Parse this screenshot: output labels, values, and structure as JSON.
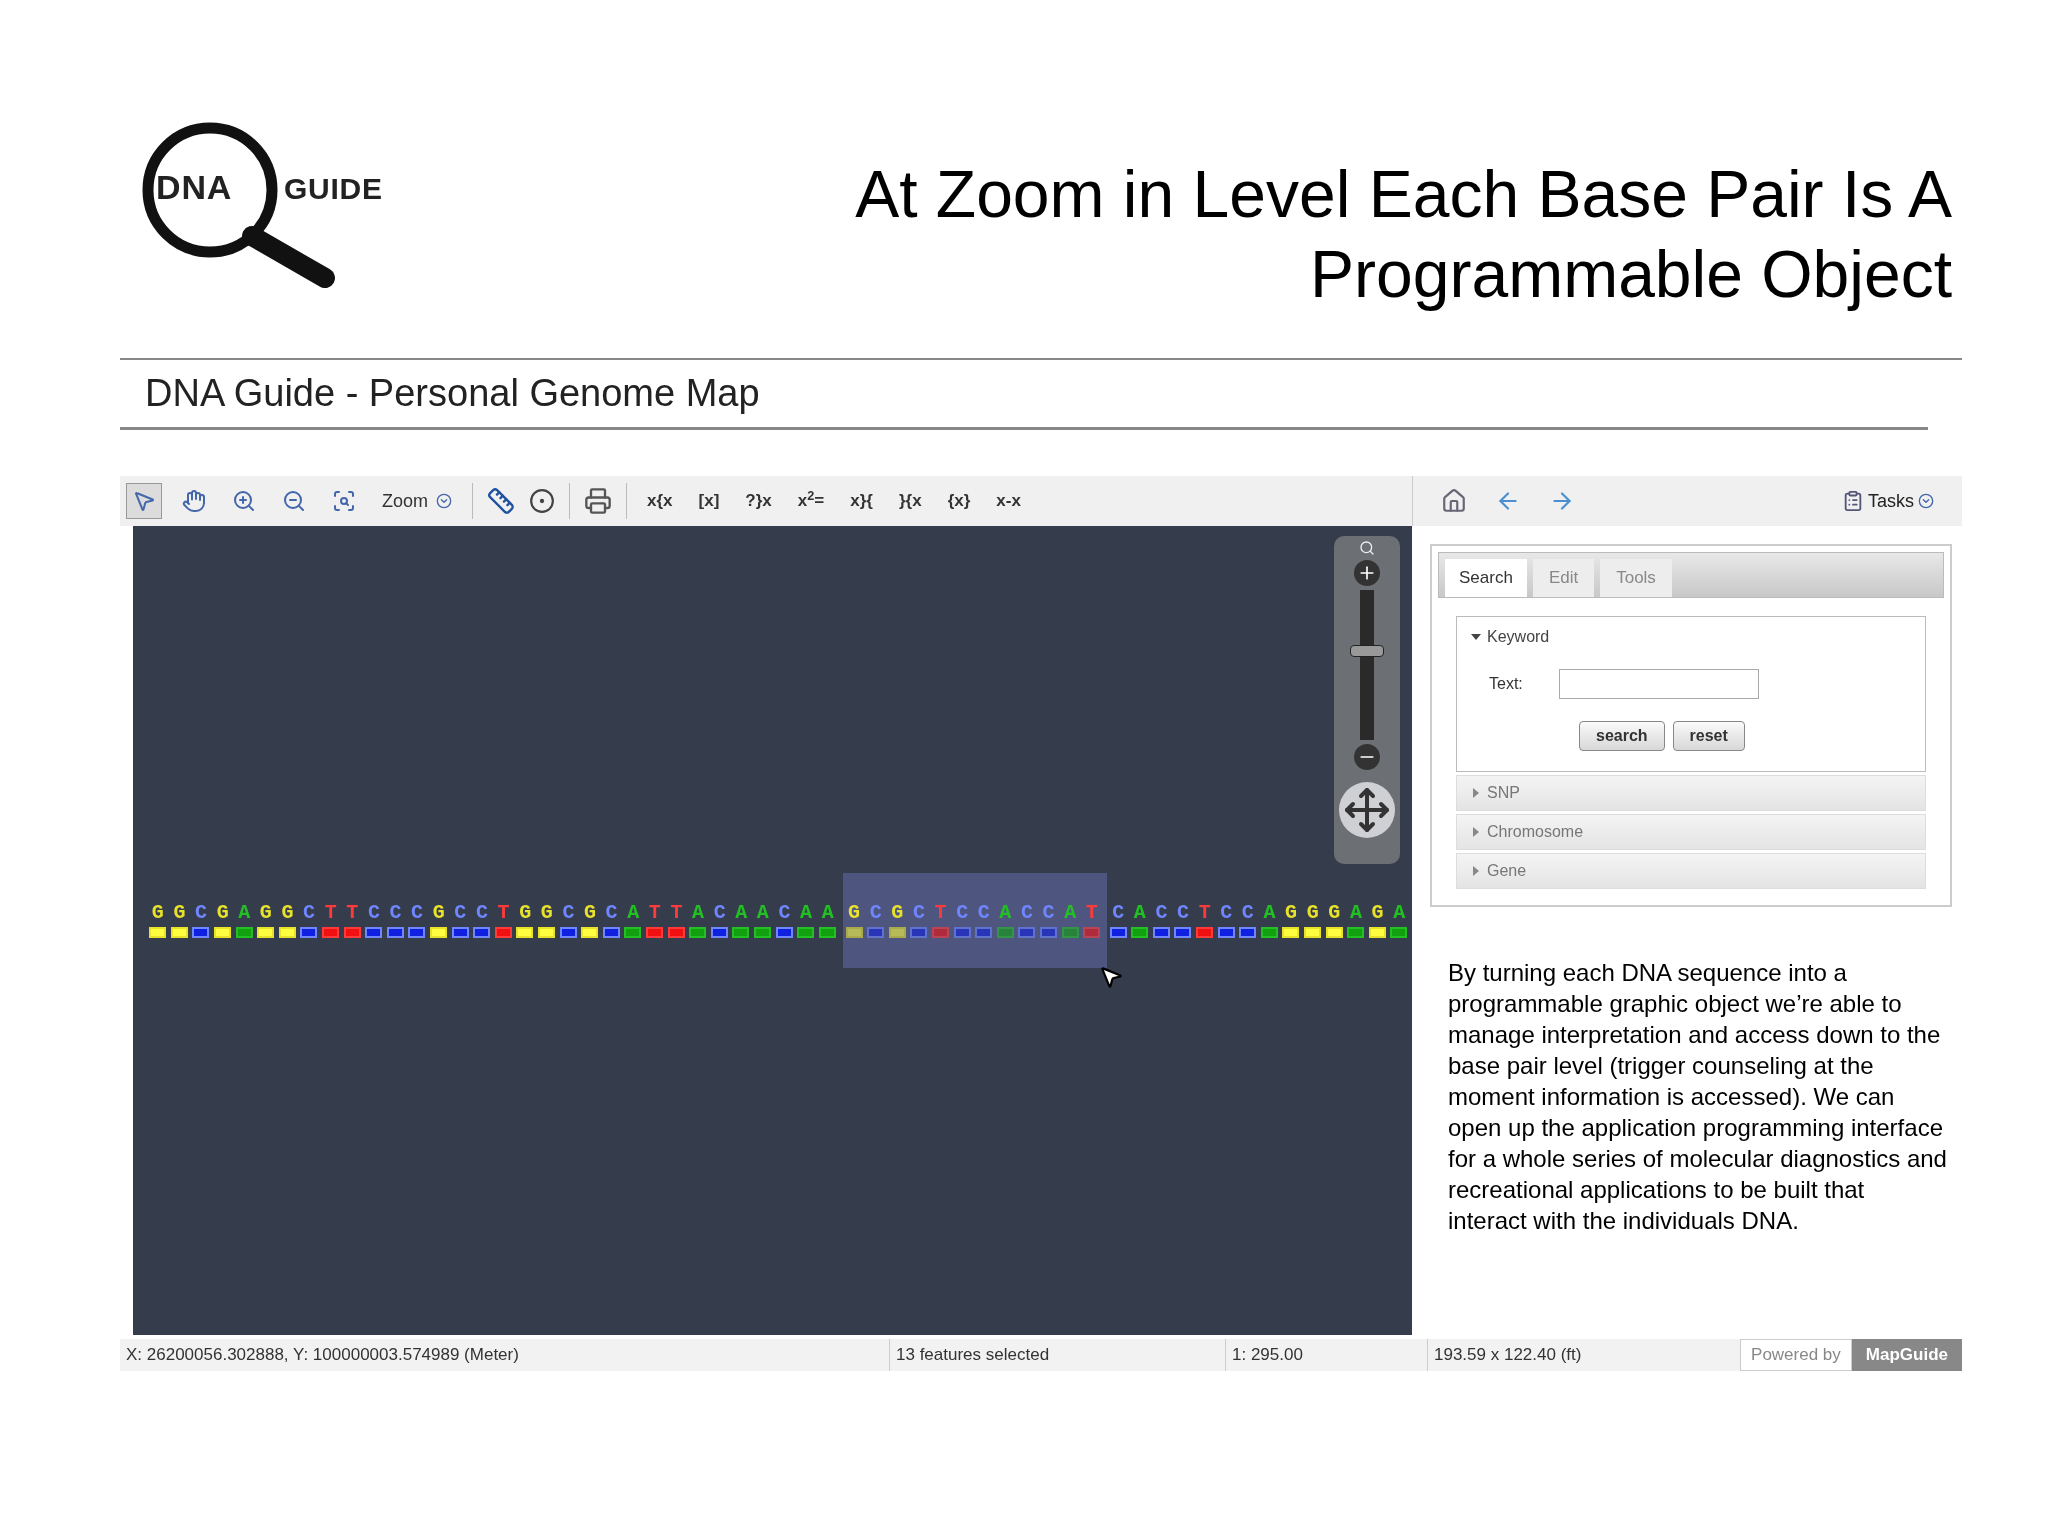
{
  "slide": {
    "logo": {
      "left": "DNA",
      "right": "GUIDE"
    },
    "title_lines": [
      "At Zoom in Level Each Base Pair Is A",
      "Programmable Object"
    ]
  },
  "app": {
    "title": "DNA Guide - Personal Genome Map",
    "toolbar": {
      "tools": [
        {
          "kind": "select",
          "selected": true
        },
        {
          "kind": "pan",
          "selected": false
        },
        {
          "kind": "zoom-in",
          "selected": false
        },
        {
          "kind": "zoom-out",
          "selected": false
        },
        {
          "kind": "zoom-rect",
          "selected": false
        }
      ],
      "zoom_menu": "Zoom",
      "formula_buttons": [
        "x{x",
        "[x]",
        "?}x",
        "x$^{2}$=",
        "x}{",
        "}{x",
        "{x}",
        "x-x"
      ]
    },
    "tasks_label": "Tasks",
    "zoom_slider": {
      "level": 0.6
    },
    "sequence": [
      {
        "letters": "GGCGAGGCTTCCCGCCTGGCGCATTACAACAA",
        "selected": false
      },
      {
        "letters": "GCGCTCCACCAT",
        "selected": true
      },
      {
        "letters": "CACCTCCAGGGAGA",
        "selected": false
      }
    ],
    "tabs": [
      {
        "label": "Search",
        "selected": true
      },
      {
        "label": "Edit",
        "selected": false
      },
      {
        "label": "Tools",
        "selected": false
      }
    ],
    "sections": [
      {
        "title": "Keyword",
        "expanded": true,
        "field_label": "Text:",
        "buttons": [
          "search",
          "reset"
        ]
      },
      {
        "title": "SNP",
        "expanded": false
      },
      {
        "title": "Chromosome",
        "expanded": false
      },
      {
        "title": "Gene",
        "expanded": false
      }
    ],
    "description": "By turning each DNA sequence into a programmable graphic object we’re able to manage interpretation and access down to the base pair level (trigger counseling at the moment information is accessed).  We can open up the application programming interface for a whole series of molecular diagnostics and recreational applications to be built that interact with the individuals DNA.",
    "status_bar": {
      "coordinates": "X: 26200056.302888, Y: 100000003.574989 (Meter)",
      "selection": "13 features selected",
      "scale": "1: 295.00",
      "size": "193.59 x 122.40 (ft)",
      "powered_by": "Powered by",
      "brand": "MapGuide"
    }
  }
}
